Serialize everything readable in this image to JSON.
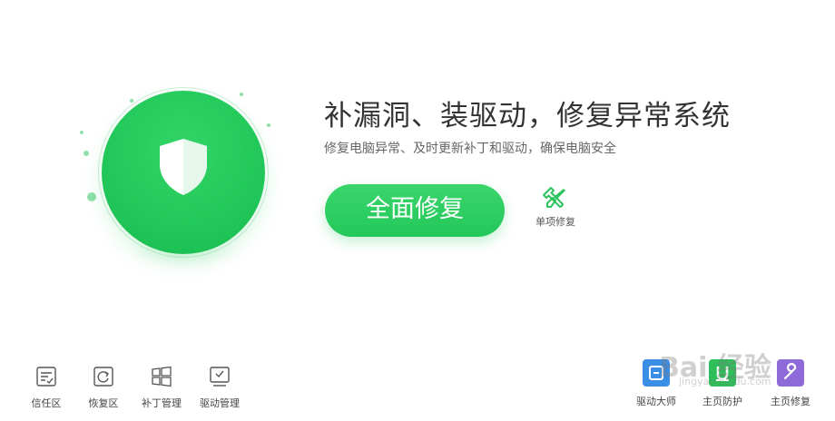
{
  "hero": {
    "headline": "补漏洞、装驱动，修复异常系统",
    "subline": "修复电脑异常、及时更新补丁和驱动，确保电脑安全",
    "main_button": "全面修复",
    "single_repair": "单项修复",
    "icons": {
      "status": "shield-icon",
      "single_repair": "wrench-screwdriver-icon"
    },
    "colors": {
      "accent": "#22c95a"
    }
  },
  "bottom_left": [
    {
      "label": "信任区",
      "icon": "trust-list-icon"
    },
    {
      "label": "恢复区",
      "icon": "restore-icon"
    },
    {
      "label": "补丁管理",
      "icon": "windows-patch-icon"
    },
    {
      "label": "驱动管理",
      "icon": "driver-manage-icon"
    }
  ],
  "bottom_right": [
    {
      "label": "驱动大师",
      "icon": "driver-master-icon",
      "color": "#3a8ee6"
    },
    {
      "label": "主页防护",
      "icon": "homepage-protect-icon",
      "color": "#2fbf5a"
    },
    {
      "label": "主页修复",
      "icon": "homepage-repair-icon",
      "color": "#8e6ad8"
    }
  ],
  "watermark": {
    "text": "Bai 经验",
    "url": "jingyan.baidu.com"
  }
}
